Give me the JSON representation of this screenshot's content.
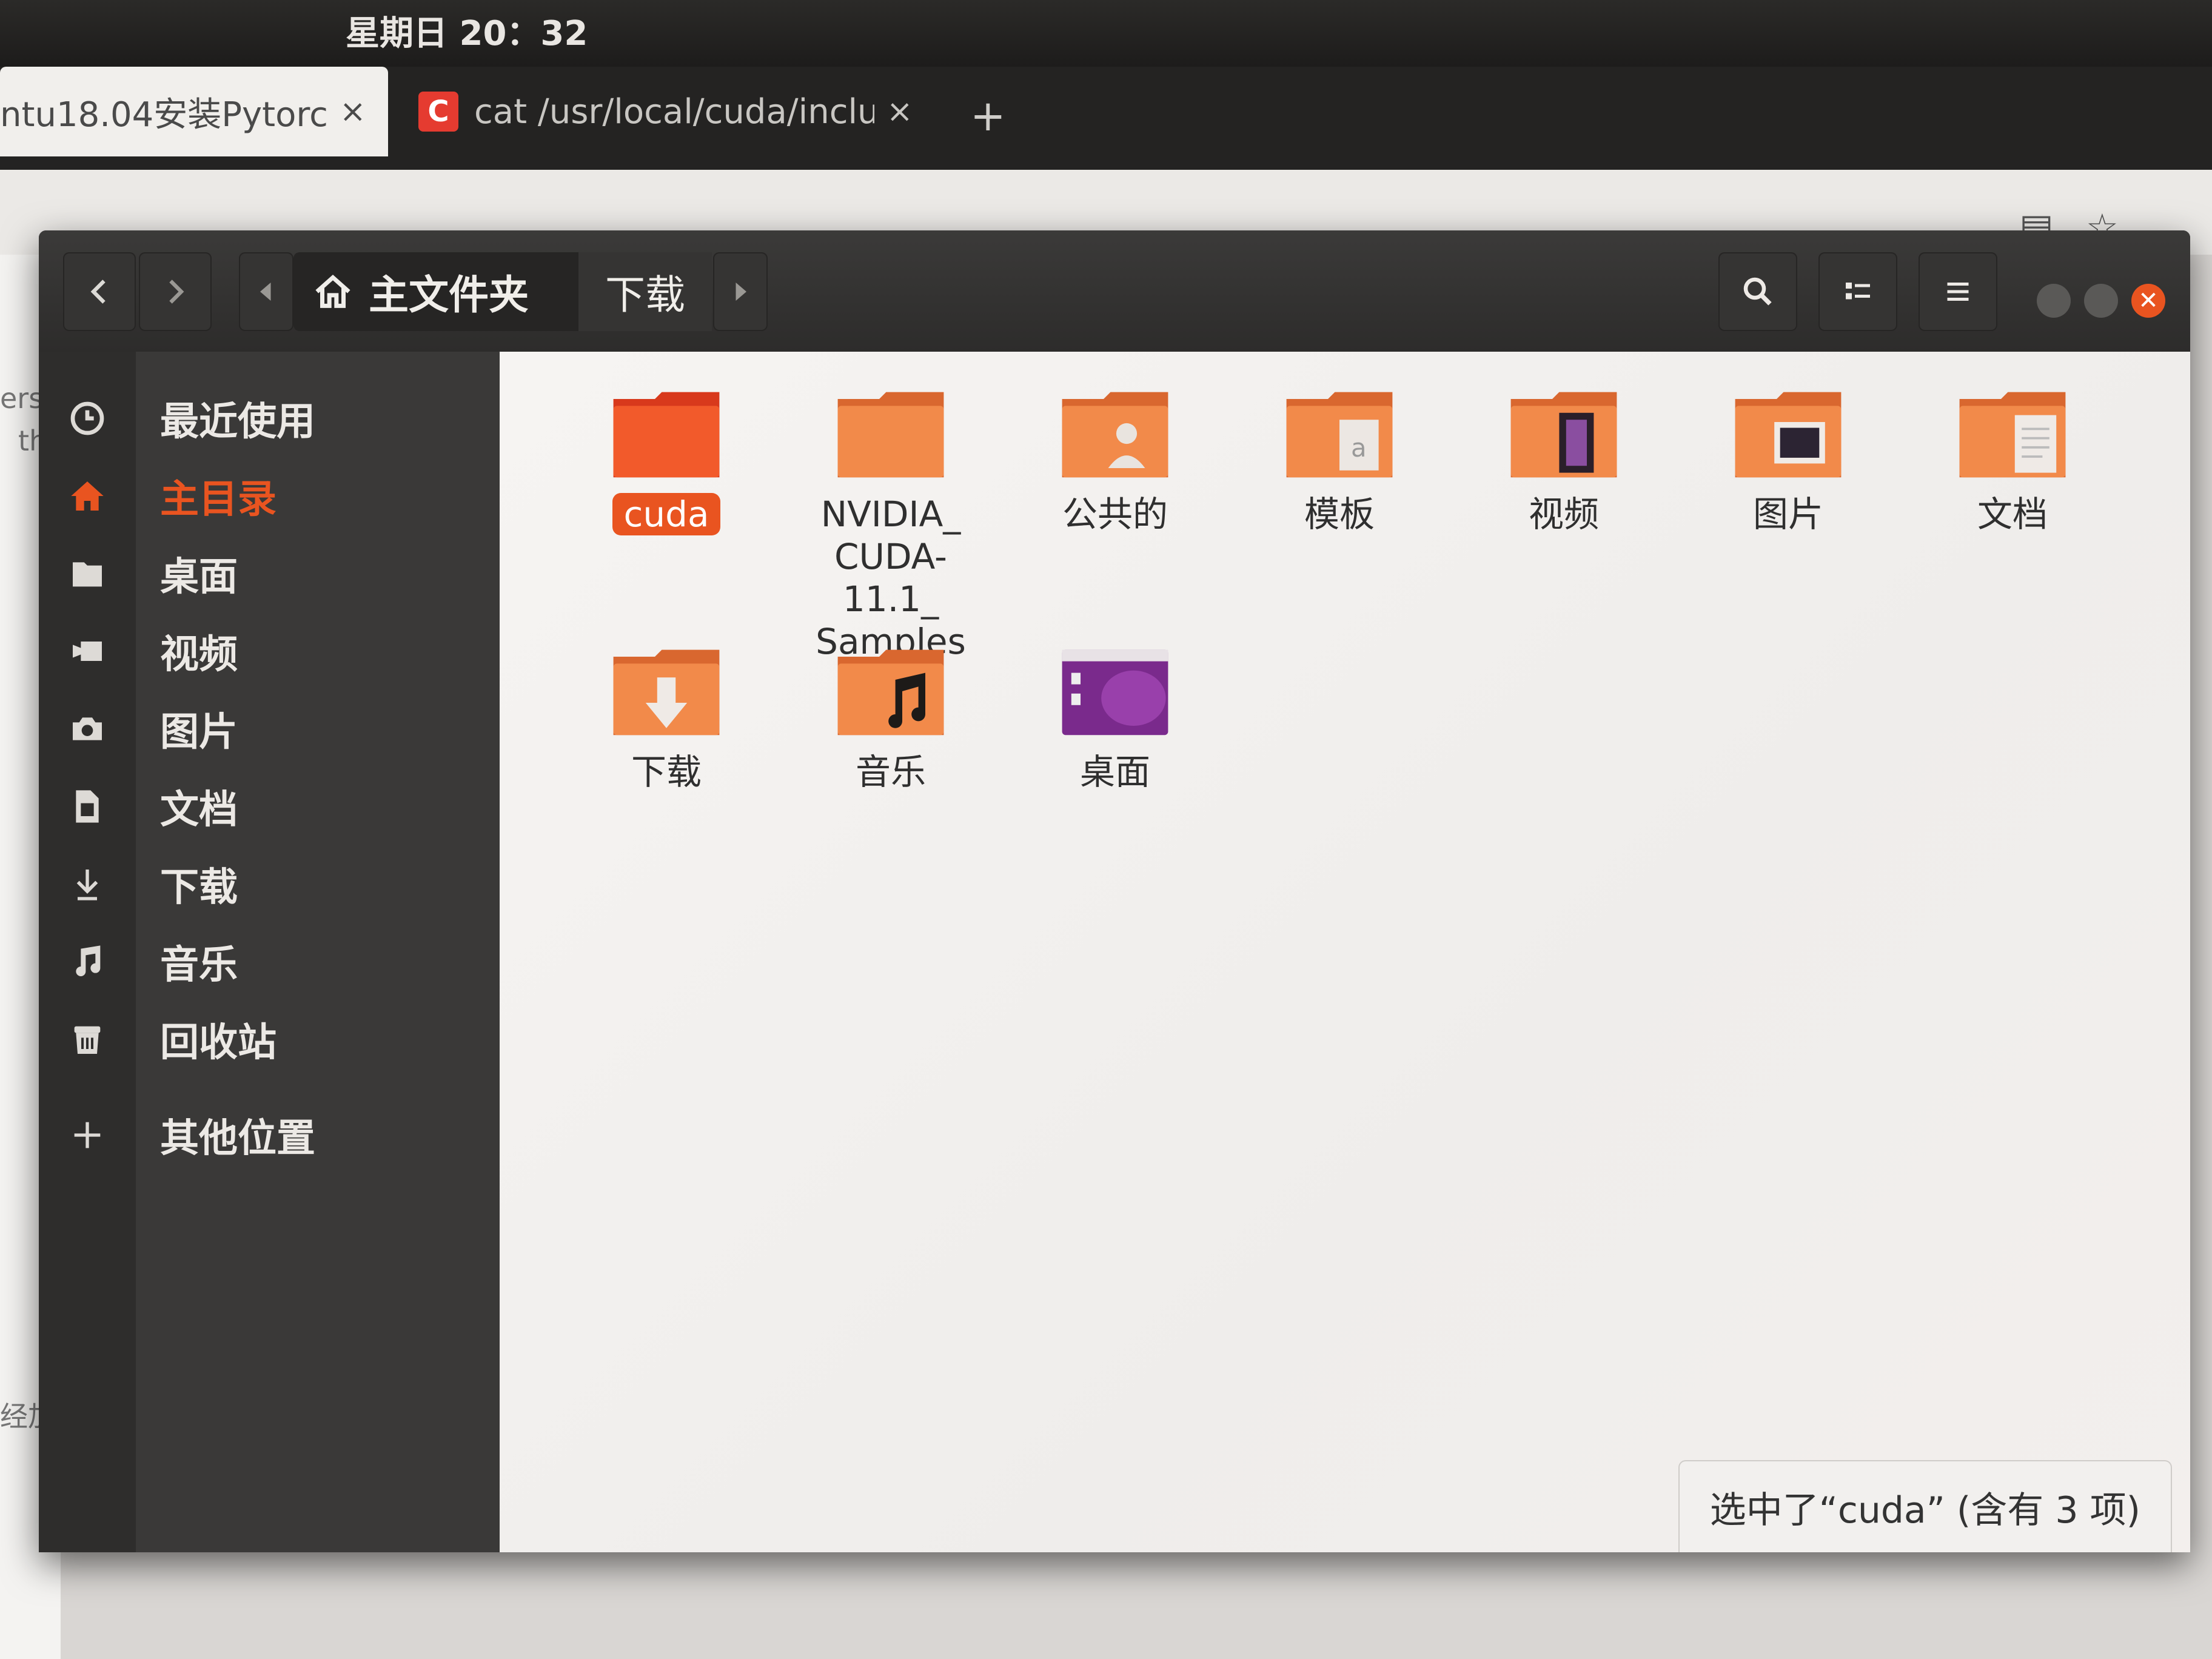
{
  "system_panel": {
    "clock": "星期日 20：32"
  },
  "browser": {
    "tabs": [
      {
        "label": "ntu18.04安装Pytorch",
        "close": "×"
      },
      {
        "favicon": "C",
        "label": "cat /usr/local/cuda/inclu",
        "close": "×"
      }
    ],
    "new_tab": "+",
    "page_fragments": [
      "ers",
      "th",
      "经加"
    ]
  },
  "file_manager": {
    "breadcrumb": {
      "home_label": "主文件夹",
      "current": "下载"
    },
    "sidebar": [
      {
        "icon": "clock-icon",
        "label": "最近使用"
      },
      {
        "icon": "home-icon",
        "label": "主目录",
        "active": true
      },
      {
        "icon": "folder-icon",
        "label": "桌面"
      },
      {
        "icon": "video-icon",
        "label": "视频"
      },
      {
        "icon": "camera-icon",
        "label": "图片"
      },
      {
        "icon": "document-icon",
        "label": "文档"
      },
      {
        "icon": "download-icon",
        "label": "下载"
      },
      {
        "icon": "music-icon",
        "label": "音乐"
      },
      {
        "icon": "trash-icon",
        "label": "回收站"
      },
      {
        "icon": "plus-icon",
        "label": "其他位置"
      }
    ],
    "items": [
      {
        "name": "cuda",
        "type": "folder",
        "selected": true
      },
      {
        "name": "NVIDIA_\nCUDA-11.1_\nSamples",
        "type": "folder"
      },
      {
        "name": "公共的",
        "type": "folder-public"
      },
      {
        "name": "模板",
        "type": "folder-templates"
      },
      {
        "name": "视频",
        "type": "folder-videos"
      },
      {
        "name": "图片",
        "type": "folder-pictures"
      },
      {
        "name": "文档",
        "type": "folder-documents"
      },
      {
        "name": "下载",
        "type": "folder-downloads"
      },
      {
        "name": "音乐",
        "type": "folder-music"
      },
      {
        "name": "桌面",
        "type": "folder-desktop"
      }
    ],
    "status": "选中了“cuda” (含有 3 项)"
  },
  "colors": {
    "accent": "#e95420",
    "folder": "#f08a4b",
    "desktop": "#7a2a8c"
  }
}
